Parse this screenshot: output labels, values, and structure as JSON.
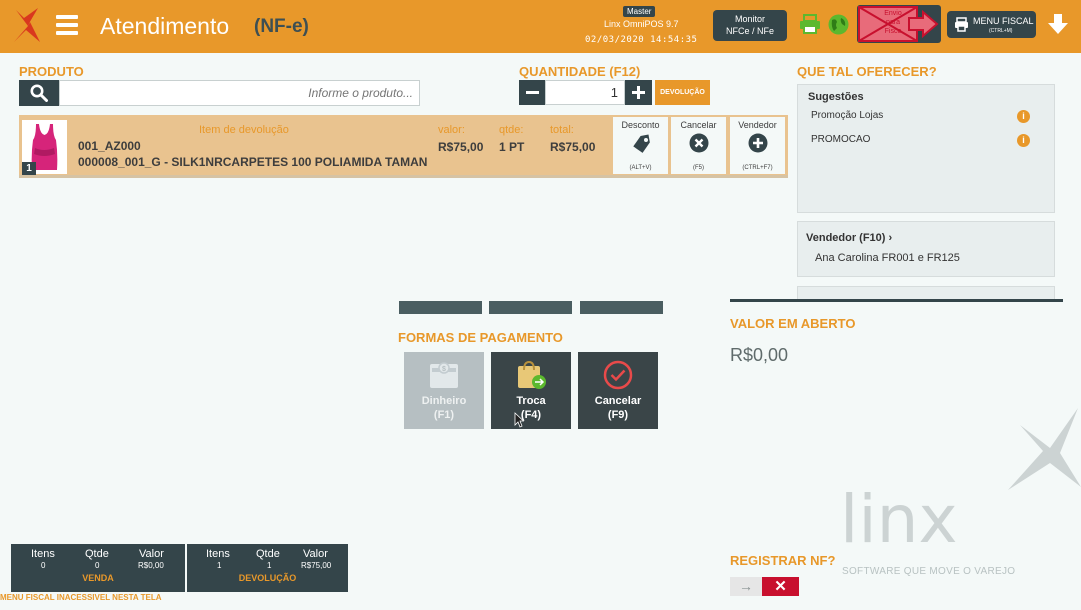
{
  "header": {
    "title": "Atendimento",
    "subtitle": "(NF-e)",
    "badge": "Master",
    "system": "Linx OmniPOS  9.7",
    "datetime": "02/03/2020 14:54:35",
    "monitor_line1": "Monitor",
    "monitor_line2": "NFCe / NFe",
    "envio_line1": "Envio",
    "envio_line2": "para",
    "envio_line3": "Fisco",
    "menu_fiscal": "MENU FISCAL",
    "menu_fiscal_shortcut": "(CTRL+M)"
  },
  "product": {
    "section_title": "PRODUTO",
    "search_placeholder": "Informe o produto..."
  },
  "quantity": {
    "section_title": "QUANTIDADE (F12)",
    "value": "1",
    "devolucao_label": "DEVOLUÇÃO"
  },
  "item": {
    "number": "1",
    "tag": "Item de devolução",
    "code": "001_AZ000",
    "description": "000008_001_G - SILK1NRCARPETES 100 POLIAMIDA TAMAN",
    "valor_label": "valor:",
    "valor": "R$75,00",
    "qtde_label": "qtde:",
    "qtde": "1 PT",
    "total_label": "total:",
    "total": "R$75,00",
    "actions": [
      {
        "label": "Desconto",
        "shortcut": "(ALT+V)"
      },
      {
        "label": "Cancelar",
        "shortcut": "(F5)"
      },
      {
        "label": "Vendedor",
        "shortcut": "(CTRL+F7)"
      }
    ]
  },
  "suggestions": {
    "section_title": "QUE TAL OFERECER?",
    "title": "Sugestões",
    "items": [
      "Promoção Lojas",
      "PROMOCAO"
    ]
  },
  "vendedor": {
    "title": "Vendedor (F10)",
    "chevron": "›",
    "name": "Ana Carolina FR001 e FR125"
  },
  "payment": {
    "section_title": "FORMAS DE PAGAMENTO",
    "methods": [
      {
        "label": "Dinheiro",
        "shortcut": "(F1)",
        "icon": "cash-icon",
        "enabled": false
      },
      {
        "label": "Troca",
        "shortcut": "(F4)",
        "icon": "exchange-bag-icon",
        "enabled": true
      },
      {
        "label": "Cancelar",
        "shortcut": "(F9)",
        "icon": "check-circle-icon",
        "enabled": true
      }
    ]
  },
  "valor_aberto": {
    "title": "VALOR EM ABERTO",
    "value": "R$0,00"
  },
  "registrar_nf": {
    "title": "REGISTRAR NF?",
    "state": "off",
    "off_symbol": "→",
    "on_symbol": "✕"
  },
  "brand": {
    "name": "linx",
    "slogan": "SOFTWARE QUE MOVE O VAREJO"
  },
  "stats": {
    "venda": {
      "title": "VENDA",
      "itens_label": "Itens",
      "itens": "0",
      "qtde_label": "Qtde",
      "qtde": "0",
      "valor_label": "Valor",
      "valor": "R$0,00"
    },
    "devolucao": {
      "title": "DEVOLUÇÃO",
      "itens_label": "Itens",
      "itens": "1",
      "qtde_label": "Qtde",
      "qtde": "1",
      "valor_label": "Valor",
      "valor": "R$75,00"
    }
  },
  "footer_note": "MENU FISCAL INACESSIVEL NESTA TELA",
  "colors": {
    "accent": "#e8982a",
    "dark": "#34454a",
    "background": "#f4f9f8",
    "danger": "#c8102e",
    "success": "#5cb82e"
  }
}
